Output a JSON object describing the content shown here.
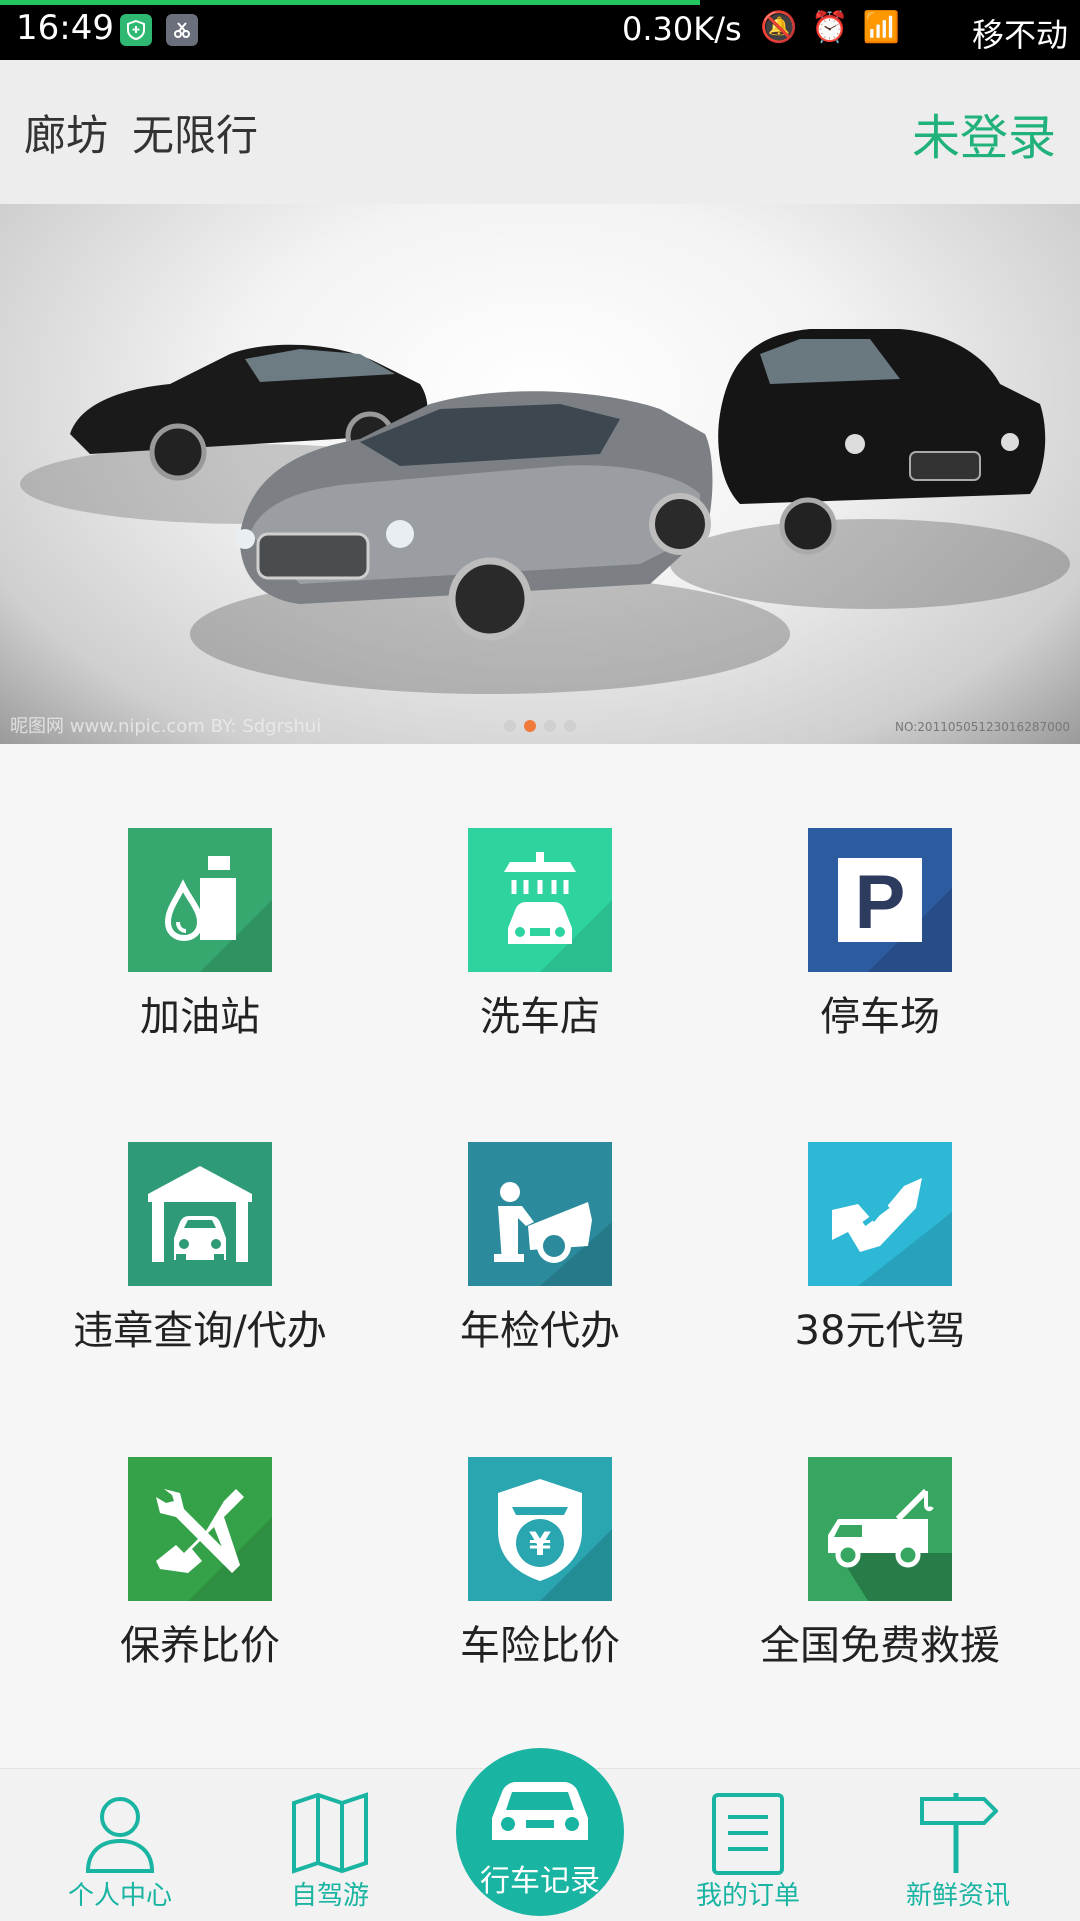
{
  "status_bar": {
    "time": "16:49",
    "network_speed": "0.30K/s",
    "carrier": "移不动",
    "icons": [
      "shield-icon",
      "scissors-icon",
      "mute-icon",
      "alarm-icon",
      "wifi-icon",
      "signal-icon"
    ]
  },
  "header": {
    "city": "廊坊",
    "restriction": "无限行",
    "login_status": "未登录"
  },
  "banner": {
    "watermark_left": "昵图网 www.nipic.com  BY: Sdgrshui",
    "watermark_right": "NO:20110505123016287000",
    "carousel_pages": 4,
    "active_page": 2
  },
  "services": [
    {
      "label": "加油站",
      "icon": "gas-station-icon",
      "color": "#36a76f"
    },
    {
      "label": "洗车店",
      "icon": "car-wash-icon",
      "color": "#2ed3a0"
    },
    {
      "label": "停车场",
      "icon": "parking-icon",
      "color": "#2d5b9f"
    },
    {
      "label": "违章查询/代办",
      "icon": "garage-icon",
      "color": "#2f9a78"
    },
    {
      "label": "年检代办",
      "icon": "mechanic-icon",
      "color": "#2b8a9b"
    },
    {
      "label": "38元代驾",
      "icon": "driver-icon",
      "color": "#2db8d6"
    },
    {
      "label": "保养比价",
      "icon": "tools-icon",
      "color": "#35a24a"
    },
    {
      "label": "车险比价",
      "icon": "insurance-shield-icon",
      "color": "#2aa6b0"
    },
    {
      "label": "全国免费救援",
      "icon": "tow-truck-icon",
      "color": "#36a660"
    }
  ],
  "bottom_nav": {
    "items": [
      {
        "label": "个人中心",
        "icon": "person-icon"
      },
      {
        "label": "自驾游",
        "icon": "map-icon"
      },
      {
        "label": "行车记录",
        "icon": "car-icon"
      },
      {
        "label": "我的订单",
        "icon": "order-list-icon"
      },
      {
        "label": "新鲜资讯",
        "icon": "signpost-icon"
      }
    ]
  },
  "colors": {
    "accent": "#20b27a",
    "nav": "#19b4a2"
  }
}
